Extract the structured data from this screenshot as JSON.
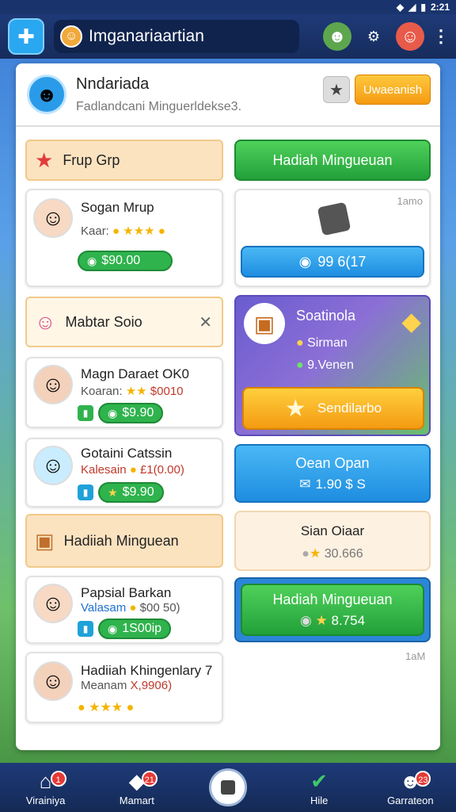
{
  "status": {
    "time": "2:21"
  },
  "topbar": {
    "title": "Imganariaartian"
  },
  "profile": {
    "name": "Nndariada",
    "subtitle": "Fadlandcani Minguerldekse3.",
    "action_label": "Uwaeanish"
  },
  "left": {
    "section1": "Frup Grp",
    "item1": {
      "title": "Sogan Mrup",
      "sub": "Kaar:",
      "price": "$90.00"
    },
    "section2": "Mabtar Soio",
    "item2": {
      "title": "Magn Daraet OK0",
      "sub": "Koaran:",
      "sub_value": "$0010",
      "price": "$9.90"
    },
    "item3": {
      "title": "Gotaini Catssin",
      "sub": "Kalesain",
      "sub_value": "£1(0.00)",
      "price": "$9.90"
    },
    "section3": "Hadiiah Minguean",
    "item4": {
      "title": "Papsial Barkan",
      "sub": "Valasam",
      "sub_value": "$00 50)",
      "price": "1S00ip"
    },
    "item5": {
      "title": "Hadiiah Khingenlary 7",
      "sub": "Meanam",
      "sub_value": "X,9906)"
    }
  },
  "right": {
    "top_button": "Hadiah Mingueuan",
    "corner_label_1": "1amo",
    "blue_button_1": "99 6(17",
    "promo": {
      "title": "Soatinola",
      "line1": "Sirman",
      "line2": "9.Venen",
      "cta": "Sendilarbo"
    },
    "blue_card": {
      "title": "Oean Opan",
      "value": "1.90 $ S"
    },
    "beige_card": {
      "title": "Sian Oiaar",
      "value": "30.666"
    },
    "green_card": {
      "title": "Hadiah Mingueuan",
      "value": "8.754"
    },
    "corner_label_2": "1aM"
  },
  "nav": [
    {
      "label": "Virainiya",
      "badge": "1"
    },
    {
      "label": "Mamart",
      "badge": "21"
    },
    {
      "label": ""
    },
    {
      "label": "Hile"
    },
    {
      "label": "Garrateon",
      "badge": "23"
    }
  ],
  "colors": {
    "topbar": "#1e3a78",
    "green": "#2fb34d",
    "blue": "#1e8de0",
    "orange": "#f49b12",
    "beige": "#fbe3c0"
  }
}
